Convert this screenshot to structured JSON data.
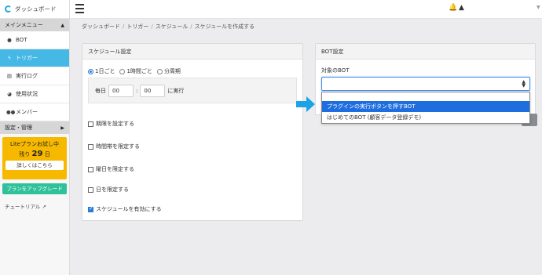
{
  "sidebar": {
    "brand": "ダッシュボード",
    "main_menu": "メインメニュー",
    "items": [
      {
        "label": "BOT",
        "icon": "robot-icon"
      },
      {
        "label": "トリガー",
        "icon": "bolt-icon",
        "active": true
      },
      {
        "label": "実行ログ",
        "icon": "log-icon"
      },
      {
        "label": "使用状況",
        "icon": "pie-chart-icon"
      },
      {
        "label": "メンバー",
        "icon": "users-icon"
      }
    ],
    "settings": "設定・管理",
    "lite": {
      "title": "Liteプランお試し中",
      "remain_prefix": "残り",
      "days": "29",
      "remain_suffix": "日",
      "more": "詳しくはこちら"
    },
    "upgrade": "プランをアップグレード",
    "tutorial": "チュートリアル"
  },
  "breadcrumb": [
    "ダッシュボード",
    "トリガー",
    "スケジュール",
    "スケジュールを作成する"
  ],
  "schedule": {
    "title": "スケジュール設定",
    "radios": [
      {
        "label": "1日ごと",
        "checked": true
      },
      {
        "label": "1時間ごと",
        "checked": false
      },
      {
        "label": "分周期",
        "checked": false
      }
    ],
    "daily_label": "毎日",
    "hour": "00",
    "colon": ":",
    "minute": "00",
    "exec_label": "に実行",
    "checks": [
      {
        "label": "期限を設定する",
        "checked": false
      },
      {
        "label": "時間帯を限定する",
        "checked": false
      },
      {
        "label": "曜日を限定する",
        "checked": false
      },
      {
        "label": "日を限定する",
        "checked": false
      },
      {
        "label": "スケジュールを有効にする",
        "checked": true
      }
    ]
  },
  "bot": {
    "title": "BOT設定",
    "target_label": "対象のBOT",
    "options": [
      "プラグインの実行ボタンを押すBOT",
      "はじめてのBOT (顧客データ登録デモ)"
    ],
    "highlighted_index": 0
  },
  "colors": {
    "accent": "#45b8e6",
    "lite": "#f7b900",
    "upgrade": "#2fc19a",
    "selected": "#1f6ee0"
  }
}
